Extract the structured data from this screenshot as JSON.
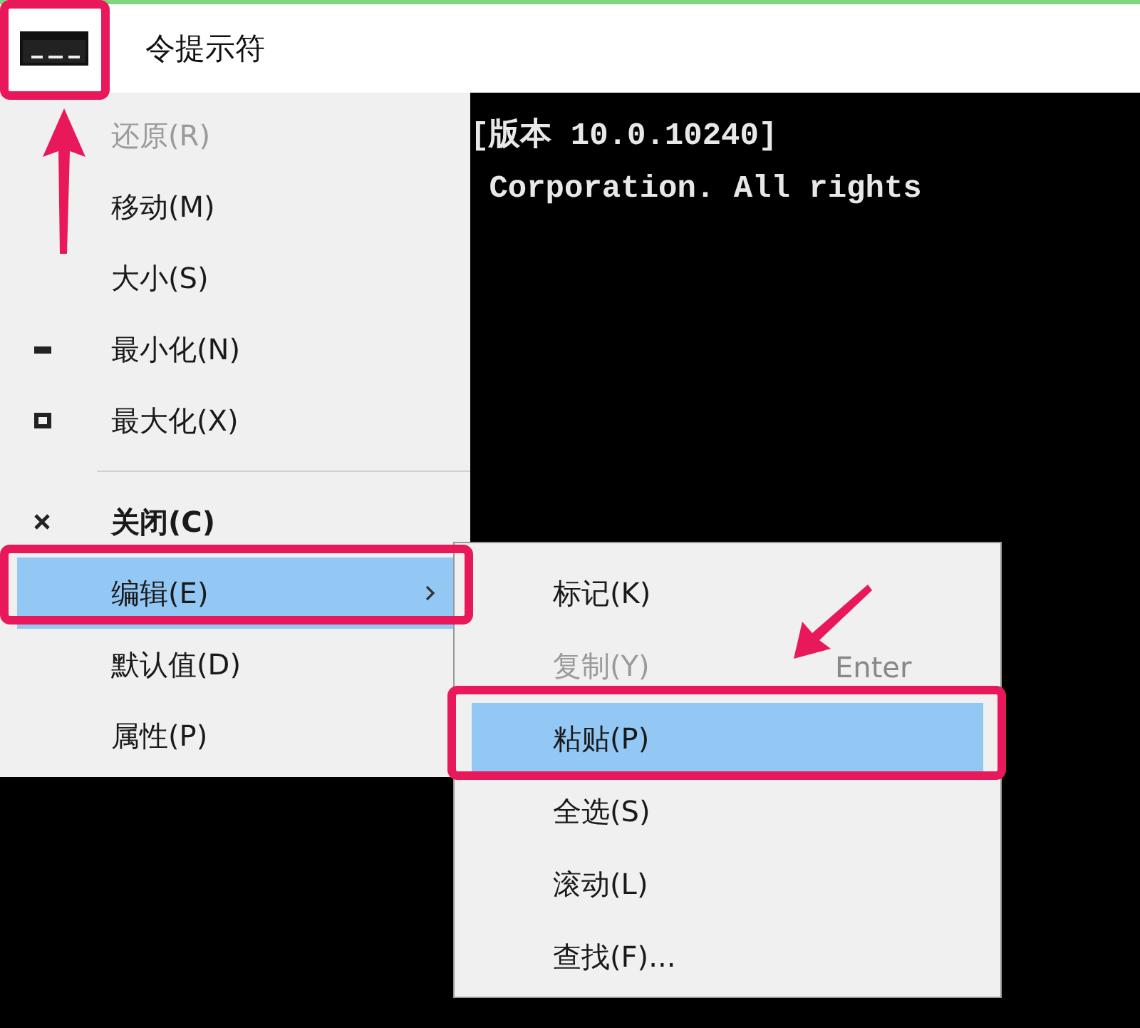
{
  "window": {
    "title": "令提示符"
  },
  "console": {
    "lines": [
      "[版本 10.0.10240]",
      " Corporation. All rights"
    ]
  },
  "system_menu": {
    "items": [
      {
        "label": "还原(R)",
        "kind": "plain",
        "disabled": true,
        "selected": false
      },
      {
        "label": "移动(M)",
        "kind": "plain",
        "disabled": false,
        "selected": false
      },
      {
        "label": "大小(S)",
        "kind": "plain",
        "disabled": false,
        "selected": false
      },
      {
        "label": "最小化(N)",
        "kind": "minimize",
        "disabled": false,
        "selected": false
      },
      {
        "label": "最大化(X)",
        "kind": "maximize",
        "disabled": false,
        "selected": false
      },
      {
        "kind": "separator"
      },
      {
        "label": "关闭(C)",
        "kind": "close",
        "disabled": false,
        "selected": false
      },
      {
        "label": "编辑(E)",
        "kind": "submenu",
        "disabled": false,
        "selected": true
      },
      {
        "label": "默认值(D)",
        "kind": "plain",
        "disabled": false,
        "selected": false
      },
      {
        "label": "属性(P)",
        "kind": "plain",
        "disabled": false,
        "selected": false
      }
    ]
  },
  "edit_submenu": {
    "items": [
      {
        "label": "标记(K)",
        "disabled": false,
        "selected": false
      },
      {
        "label": "复制(Y)",
        "shortcut": "Enter",
        "disabled": true,
        "selected": false
      },
      {
        "label": "粘贴(P)",
        "disabled": false,
        "selected": true
      },
      {
        "label": "全选(S)",
        "disabled": false,
        "selected": false
      },
      {
        "label": "滚动(L)",
        "disabled": false,
        "selected": false
      },
      {
        "label": "查找(F)...",
        "disabled": false,
        "selected": false
      }
    ]
  }
}
